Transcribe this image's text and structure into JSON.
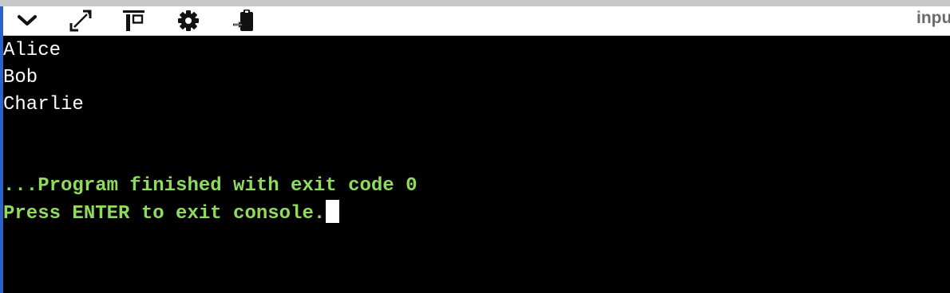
{
  "toolbar": {
    "tools": [
      {
        "icon": "chevron-down-icon"
      },
      {
        "icon": "expand-arrows-icon"
      },
      {
        "icon": "layout-panel-icon"
      },
      {
        "icon": "gear-icon"
      },
      {
        "icon": "clipboard-export-icon"
      }
    ],
    "tab_label": "input"
  },
  "console": {
    "output_lines": [
      "Alice",
      "Bob",
      "Charlie"
    ],
    "finished_message": "...Program finished with exit code 0",
    "exit_prompt": "Press ENTER to exit console."
  },
  "colors": {
    "output_text": "#ffffff",
    "status_text": "#8fdc5c",
    "background": "#000000",
    "toolbar_background": "#ffffff",
    "left_accent": "#2b63c6"
  }
}
